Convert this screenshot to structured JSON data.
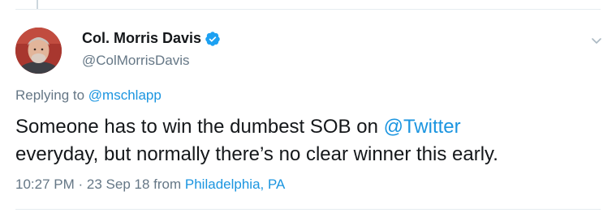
{
  "tweet": {
    "display_name": "Col. Morris Davis",
    "verified": true,
    "username": "@ColMorrisDavis",
    "replying_prefix": "Replying to",
    "replying_to": "@mschlapp",
    "text_part1": "Someone has to win the dumbest SOB on ",
    "text_mention": "@Twitter",
    "text_part2": "everyday, but normally there’s no clear winner this early.",
    "time": "10:27 PM",
    "separator": "·",
    "date": "23 Sep 18",
    "from_label": "from",
    "location": "Philadelphia, PA"
  },
  "icons": {
    "verified": "verified-badge-icon",
    "menu": "chevron-down-icon"
  },
  "colors": {
    "link": "#1b95e0",
    "secondary_text": "#657786",
    "primary_text": "#14171a",
    "verified": "#1da1f2"
  }
}
